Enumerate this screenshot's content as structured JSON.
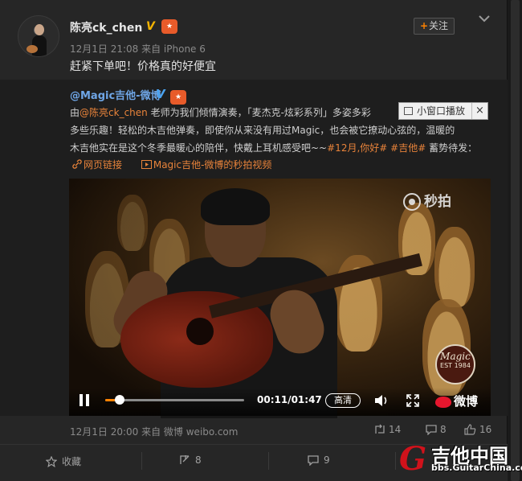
{
  "post": {
    "username": "陈亮ck_chen",
    "meta": "12月1日 21:08 来自 iPhone 6",
    "text": "赶紧下单吧！价格真的好便宜",
    "follow_label": "关注"
  },
  "retweet": {
    "username": "@Magic吉他-微博",
    "line1_pre": "由",
    "line1_mention": "@陈亮ck_chen",
    "line1_post": " 老师为我们倾情演奏，「麦杰克-炫彩系列」多姿多彩",
    "line2": "多些乐趣！轻松的木吉他弹奏，即使你从来没有用过Magic，也会被它撩动心弦的，温暖的",
    "line3_pre": "木吉他实在是这个冬季最暖心的陪伴，快戴上耳机感受吧~~",
    "line3_tags": "#12月,你好# #吉他#",
    "line3_post": " 蓄势待发：",
    "link1": "网页链接",
    "link2": "Magic吉他-微博的秒拍视频",
    "meta": "12月1日 20:00 来自 微博 weibo.com",
    "stats": {
      "reposts": "14",
      "comments": "8",
      "likes": "16"
    }
  },
  "popup": {
    "label": "小窗口播放",
    "close": "×"
  },
  "video": {
    "watermark": "秒拍",
    "seal_brand": "Magic",
    "seal_year": "EST 1984",
    "time": "00:11/01:47",
    "quality": "高清",
    "brand": "微博",
    "progress": 0.07
  },
  "footer": {
    "favorite": "收藏",
    "repost": "8",
    "comment": "9"
  },
  "site_watermark": {
    "logo": "G",
    "name": "吉他中国",
    "url": "bbs.GuitarChina.com"
  },
  "colors": {
    "accent": "#ff8200",
    "link": "#e8833a",
    "verified": "#f4b400"
  },
  "icons": [
    "chevron-down-icon",
    "repost-icon",
    "comment-icon",
    "like-icon",
    "favorite-icon",
    "pause-icon",
    "volume-icon",
    "fullscreen-icon",
    "link-icon",
    "video-icon"
  ]
}
